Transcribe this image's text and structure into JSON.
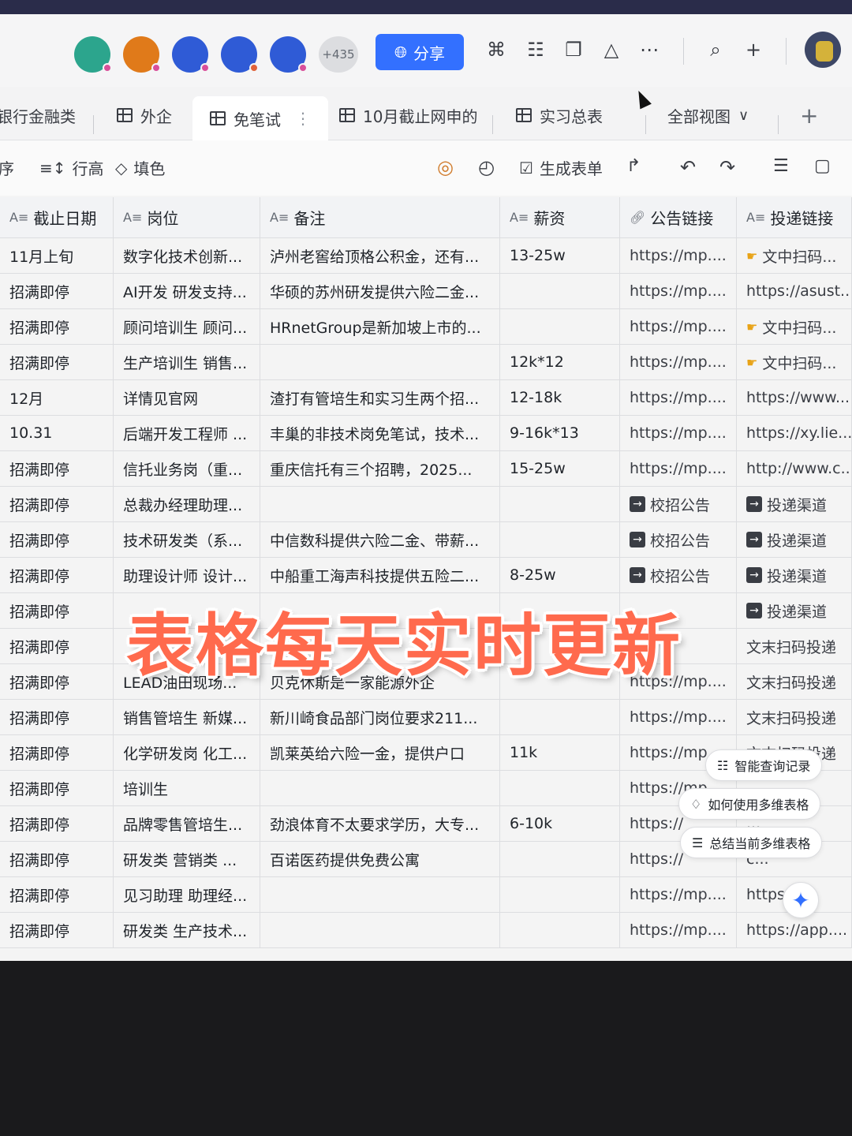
{
  "header": {
    "more_count": "+435",
    "share_label": "分享",
    "avatars": [
      {
        "color": "#2ca58d",
        "dot": "#d94f9a"
      },
      {
        "color": "#e07a1a",
        "dot": "#d94f9a"
      },
      {
        "color": "#2f5bd6",
        "dot": "#d94f9a"
      },
      {
        "color": "#2f5bd6",
        "dot": "#e0623a"
      },
      {
        "color": "#2f5bd6",
        "dot": "#d94f9a"
      }
    ]
  },
  "tabs": [
    {
      "label": "银行金融类"
    },
    {
      "label": "外企"
    },
    {
      "label": "免笔试",
      "active": true
    },
    {
      "label": "10月截止网申的"
    },
    {
      "label": "实习总表"
    },
    {
      "label": "全部视图"
    }
  ],
  "toolbar": {
    "sort_label": "序",
    "row_height_label": "行高",
    "fill_color_label": "填色",
    "generate_form_label": "生成表单"
  },
  "columns": [
    "截止日期",
    "岗位",
    "备注",
    "薪资",
    "公告链接",
    "投递链接"
  ],
  "rows": [
    [
      "11月上旬",
      "数字化技术创新...",
      "泸州老窖给顶格公积金，还有...",
      "13-25w",
      "https://mp....",
      "文中扫码..."
    ],
    [
      "招满即停",
      "AI开发 研发支持...",
      "华硕的苏州研发提供六险二金...",
      "",
      "https://mp....",
      "https://asust..."
    ],
    [
      "招满即停",
      "顾问培训生 顾问...",
      "HRnetGroup是新加坡上市的...",
      "",
      "https://mp....",
      "文中扫码..."
    ],
    [
      "招满即停",
      "生产培训生 销售...",
      "",
      "12k*12",
      "https://mp....",
      "文中扫码..."
    ],
    [
      "12月",
      "详情见官网",
      "渣打有管培生和实习生两个招...",
      "12-18k",
      "https://mp....",
      "https://www...."
    ],
    [
      "10.31",
      "后端开发工程师 ...",
      "丰巢的非技术岗免笔试，技术...",
      "9-16k*13",
      "https://mp....",
      "https://xy.lie..."
    ],
    [
      "招满即停",
      "信托业务岗（重...",
      "重庆信托有三个招聘，2025...",
      "15-25w",
      "https://mp....",
      "http://www.c..."
    ],
    [
      "招满即停",
      "总裁办经理助理...",
      "",
      "",
      "校招公告",
      "投递渠道"
    ],
    [
      "招满即停",
      "技术研发类（系...",
      "中信数科提供六险二金、带薪...",
      "",
      "校招公告",
      "投递渠道"
    ],
    [
      "招满即停",
      "助理设计师 设计...",
      "中船重工海声科技提供五险二...",
      "8-25w",
      "校招公告",
      "投递渠道"
    ],
    [
      "招满即停",
      "",
      "",
      "",
      "",
      "投递渠道"
    ],
    [
      "招满即停",
      "",
      "",
      "",
      "",
      "文末扫码投递"
    ],
    [
      "招满即停",
      "LEAD油田现场...",
      "贝克休斯是一家能源外企",
      "",
      "https://mp....",
      "文末扫码投递"
    ],
    [
      "招满即停",
      "销售管培生 新媒...",
      "新川崎食品部门岗位要求211...",
      "",
      "https://mp....",
      "文末扫码投递"
    ],
    [
      "招满即停",
      "化学研发岗 化工...",
      "凯莱英给六险一金，提供户口",
      "11k",
      "https://mp....",
      "文末扫码投递"
    ],
    [
      "招满即停",
      "培训生",
      "",
      "",
      "https://mp....",
      "..."
    ],
    [
      "招满即停",
      "品牌零售管培生...",
      "劲浪体育不太要求学历，大专...",
      "6-10k",
      "https://",
      "..."
    ],
    [
      "招满即停",
      "研发类 营销类 ...",
      "百诺医药提供免费公寓",
      "",
      "https://",
      "c..."
    ],
    [
      "招满即停",
      "见习助理 助理经...",
      "",
      "",
      "https://mp....",
      "https:..."
    ],
    [
      "招满即停",
      "研发类 生产技术...",
      "",
      "",
      "https://mp....",
      "https://app...."
    ]
  ],
  "overlay_title": "表格每天实时更新",
  "ai_panel": {
    "items": [
      "智能查询记录",
      "如何使用多维表格",
      "总结当前多维表格"
    ]
  }
}
